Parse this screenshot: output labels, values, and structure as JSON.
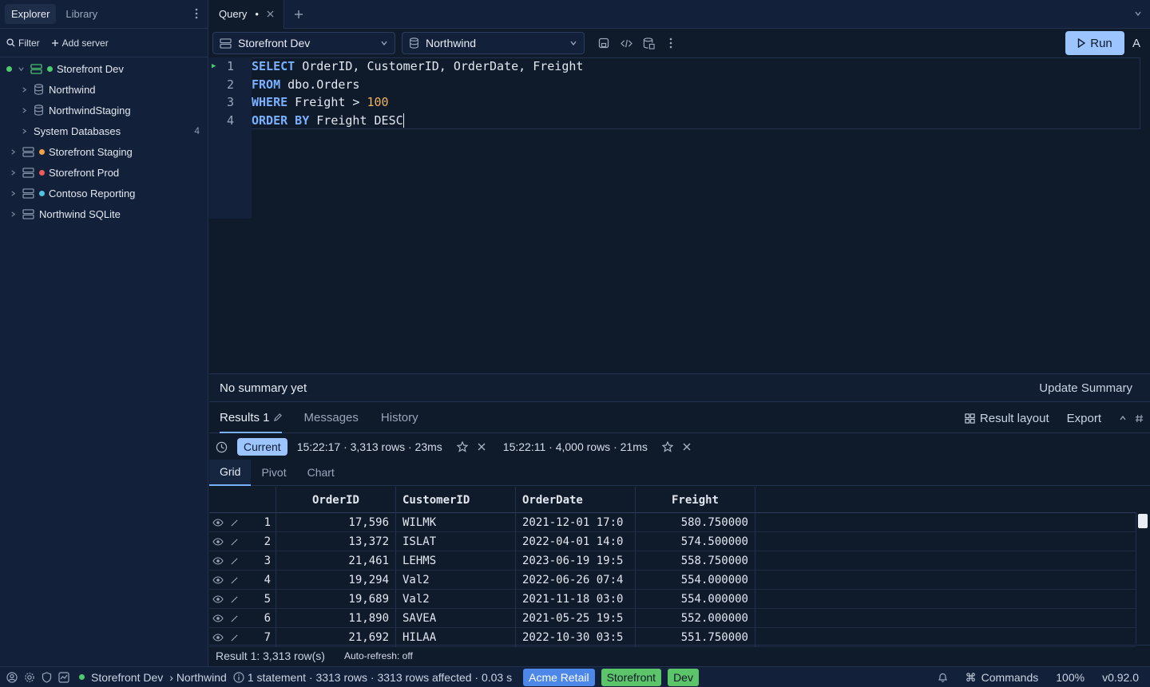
{
  "sidebar": {
    "tabs": [
      "Explorer",
      "Library"
    ],
    "filter_label": "Filter",
    "add_server_label": "Add server",
    "tree": [
      {
        "label": "Storefront Dev",
        "status": "#4ecb71"
      },
      {
        "label": "Northwind"
      },
      {
        "label": "NorthwindStaging"
      },
      {
        "label": "System Databases",
        "count": "4"
      },
      {
        "label": "Storefront Staging",
        "status": "#f0a24a"
      },
      {
        "label": "Storefront Prod",
        "status": "#ef5a5a"
      },
      {
        "label": "Contoso Reporting",
        "status": "#52c3e0"
      },
      {
        "label": "Northwind SQLite"
      }
    ]
  },
  "tabs": {
    "query_tab": "Query",
    "modified_marker": "•"
  },
  "toolbar": {
    "server_select": "Storefront Dev",
    "database_select": "Northwind",
    "run_label": "Run",
    "extra_label": "A"
  },
  "editor": {
    "line_numbers": [
      "1",
      "2",
      "3",
      "4"
    ],
    "lines": [
      [
        {
          "t": "SELECT",
          "k": "kw"
        },
        {
          "t": " OrderID, CustomerID, OrderDate, Freight"
        }
      ],
      [
        {
          "t": "FROM",
          "k": "kw"
        },
        {
          "t": " dbo.Orders"
        }
      ],
      [
        {
          "t": "WHERE",
          "k": "kw"
        },
        {
          "t": " Freight > "
        },
        {
          "t": "100",
          "k": "num"
        }
      ],
      [
        {
          "t": "ORDER BY",
          "k": "kw"
        },
        {
          "t": " Freight DESC"
        }
      ]
    ]
  },
  "summary": {
    "title": "No summary yet",
    "update_label": "Update Summary"
  },
  "results": {
    "tabs": [
      "Results 1",
      "Messages",
      "History"
    ],
    "layout_label": "Result layout",
    "export_label": "Export",
    "history": {
      "current_label": "Current",
      "run1": "15:22:17 · 3,313 rows · 23ms",
      "run2": "15:22:11 · 4,000 rows · 21ms"
    },
    "view_tabs": [
      "Grid",
      "Pivot",
      "Chart"
    ],
    "columns": [
      "OrderID",
      "CustomerID",
      "OrderDate",
      "Freight"
    ],
    "rows": [
      [
        "1",
        "17,596",
        "WILMK",
        "2021-12-01 17:0",
        "580.750000"
      ],
      [
        "2",
        "13,372",
        "ISLAT",
        "2022-04-01 14:0",
        "574.500000"
      ],
      [
        "3",
        "21,461",
        "LEHMS",
        "2023-06-19 19:5",
        "558.750000"
      ],
      [
        "4",
        "19,294",
        "Val2",
        "2022-06-26 07:4",
        "554.000000"
      ],
      [
        "5",
        "19,689",
        "Val2",
        "2021-11-18 03:0",
        "554.000000"
      ],
      [
        "6",
        "11,890",
        "SAVEA",
        "2021-05-25 19:5",
        "552.000000"
      ],
      [
        "7",
        "21,692",
        "HILAA",
        "2022-10-30 03:5",
        "551.750000"
      ]
    ],
    "footer_count": "Result 1: 3,313 row(s)",
    "auto_refresh": "Auto-refresh: off"
  },
  "statusbar": {
    "connection": "Storefront Dev",
    "database": "› Northwind",
    "stats": "1 statement · 3313 rows · 3313 rows affected · 0.03 s",
    "badges": [
      {
        "label": "Acme Retail",
        "color": "#4d87e8"
      },
      {
        "label": "Storefront",
        "color": "#5cc56a"
      },
      {
        "label": "Dev",
        "color": "#5cc56a"
      }
    ],
    "commands_label": "Commands",
    "zoom": "100%",
    "version": "v0.92.0"
  },
  "colors": {
    "accent": "#9cc4ff",
    "keyword": "#79b0ff",
    "number": "#f0b45a",
    "connected": "#4ecb71"
  }
}
